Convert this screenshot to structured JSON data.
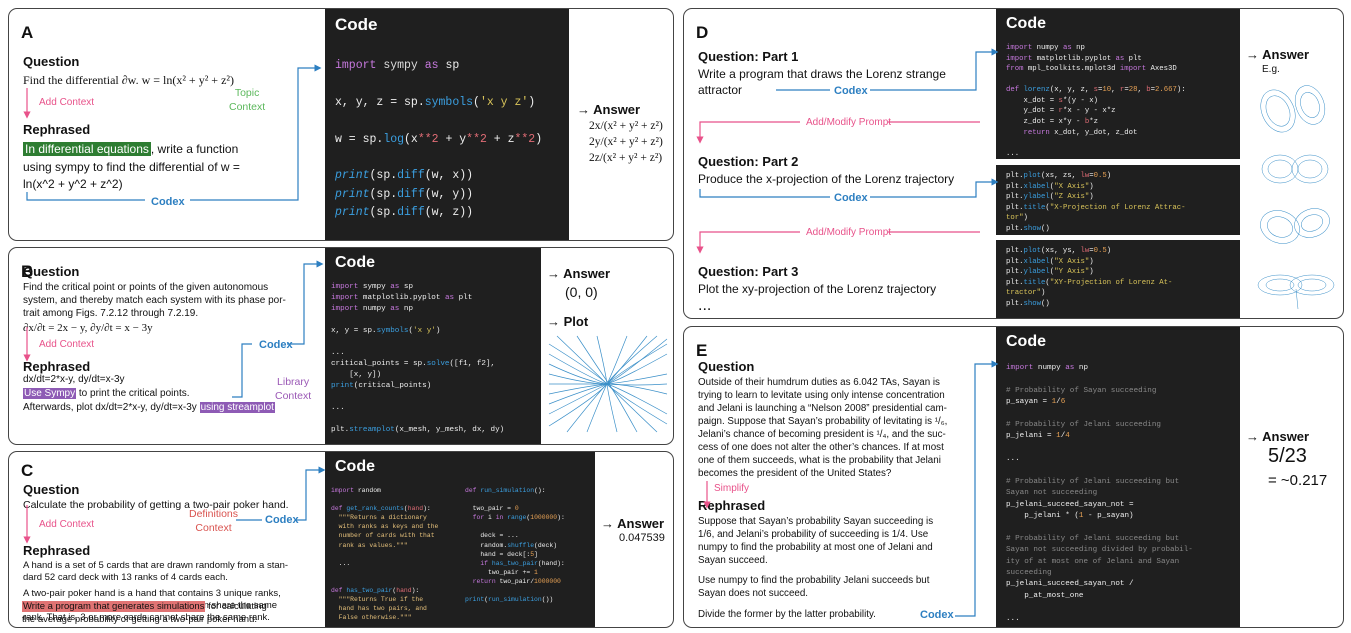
{
  "panels": {
    "A": {
      "label": "A",
      "question_title": "Question",
      "question": "Find the differential ∂w. w = ln(x² + y² + z²)",
      "add_context": "Add Context",
      "rephrased_title": "Rephrased",
      "topic_context": "Topic\nContext",
      "rephrased_highlight": "In differential equations",
      "rephrased_rest": ", write a function",
      "rephrased_2": "using sympy to find the differential of w =",
      "rephrased_3": "ln(x^2 + y^2 + z^2)",
      "codex": "Codex",
      "code_title": "Code",
      "code_lines": [
        "import sympy as sp",
        "x, y, z = sp.symbols('x y z')",
        "w = sp.log(x**2 + y**2 + z**2)",
        "print(sp.diff(w, x))",
        "print(sp.diff(w, y))",
        "print(sp.diff(w, z))"
      ],
      "answer_label": "Answer",
      "answers": [
        "2x/(x² + y² + z²)",
        "2y/(x² + y² + z²)",
        "2z/(x² + y² + z²)"
      ]
    },
    "B": {
      "label": "B",
      "question_title": "Question",
      "question_lines": [
        "Find the critical point or points of the given autonomous",
        "system, and thereby match each system with its phase por-",
        "trait among Figs. 7.2.12 through 7.2.19.",
        "∂x/∂t = 2x − y, ∂y/∂t = x − 3y"
      ],
      "add_context": "Add Context",
      "rephrased_title": "Rephrased",
      "rephrased_1": "dx/dt=2*x-y, dy/dt=x-3y",
      "rephrased_hl1": "Use Sympy",
      "rephrased_2": " to print the critical points.",
      "rephrased_3": "Afterwards, plot dx/dt=2*x-y, dy/dt=x-3y ",
      "rephrased_hl2": "using streamplot",
      "library_context": "Library\nContext",
      "codex": "Codex",
      "code_title": "Code",
      "code_lines": [
        "import sympy as sp",
        "import matplotlib.pyplot as plt",
        "import numpy as np",
        "",
        "x, y = sp.symbols('x y')",
        "",
        "...",
        "critical_points = sp.solve([f1, f2],",
        "    [x, y])",
        "print(critical_points)",
        "",
        "...",
        "",
        "plt.streamplot(x_mesh, y_mesh, dx, dy)"
      ],
      "answer_label": "Answer",
      "answer": "(0, 0)",
      "plot_label": "Plot"
    },
    "C": {
      "label": "C",
      "question_title": "Question",
      "question": "Calculate the probability of getting a two-pair poker hand.",
      "add_context": "Add Context",
      "definitions_context": "Definitions\nContext",
      "codex": "Codex",
      "rephrased_title": "Rephrased",
      "rephrased_lines": [
        "A hand is a set of 5 cards that are drawn randomly from a stan-",
        "dard 52 card deck with 13 ranks of 4 cards each.",
        "",
        "A two-pair poker hand is a hand that contains 3 unique ranks,",
        "where no more than 2 cards in the hand can share the same",
        "rank. That is, 3 or more cards cannot share the same rank."
      ],
      "rephrased_hl": "Write a program that generates simulations",
      "rephrased_tail": " for calculating",
      "rephrased_last": "the average probability of getting a two-pair poker hand.",
      "code_title": "Code",
      "answer_label": "Answer",
      "answer": "0.047539"
    },
    "D": {
      "label": "D",
      "q1_title": "Question: Part 1",
      "q1_lines": [
        "Write a program that draws the Lorenz strange",
        "attractor"
      ],
      "codex": "Codex",
      "add_modify": "Add/Modify Prompt",
      "q2_title": "Question: Part 2",
      "q2": "Produce the x-projection of the Lorenz trajectory",
      "q3_title": "Question: Part 3",
      "q3": "Plot the xy-projection of the Lorenz trajectory",
      "ellipsis": "...",
      "code_title": "Code",
      "answer_label": "Answer",
      "eg": "E.g."
    },
    "E": {
      "label": "E",
      "question_title": "Question",
      "question_lines": [
        "Outside of their humdrum duties as 6.042 TAs, Sayan is",
        "trying to learn to levitate using only intense concentration",
        "and Jelani is launching a “Nelson 2008” presidential cam-",
        "paign. Suppose that Sayan’s probability of levitating is ¹/₆,",
        "Jelani’s chance of becoming president is ¹/₄, and the suc-",
        "cess of one does not alter the other’s chances. If at most",
        "one of them succeeds, what is the probability that Jelani",
        "becomes the president of the United States?"
      ],
      "simplify": "Simplify",
      "rephrased_title": "Rephrased",
      "rephrased_lines": [
        "Suppose that Sayan’s probability Sayan succeeding is",
        "1/6, and Jelani’s probability of succeeding is 1/4. Use",
        "numpy to find the probability at most one of Jelani and",
        "Sayan succeed.",
        "",
        "Use numpy to find the probability Jelani succeeds but",
        "Sayan does not succeed.",
        "",
        "Divide the former by the latter probability."
      ],
      "codex": "Codex",
      "code_title": "Code",
      "answer_label": "Answer",
      "answer_frac": "5/23",
      "answer_approx": "= ~0.217"
    }
  },
  "colors": {
    "pink": "#e8528a",
    "blue": "#2d7fc1",
    "green": "#5cb85c",
    "purple": "#9b59b6",
    "red": "#d9534f",
    "code_bg": "#1f1f1f"
  }
}
